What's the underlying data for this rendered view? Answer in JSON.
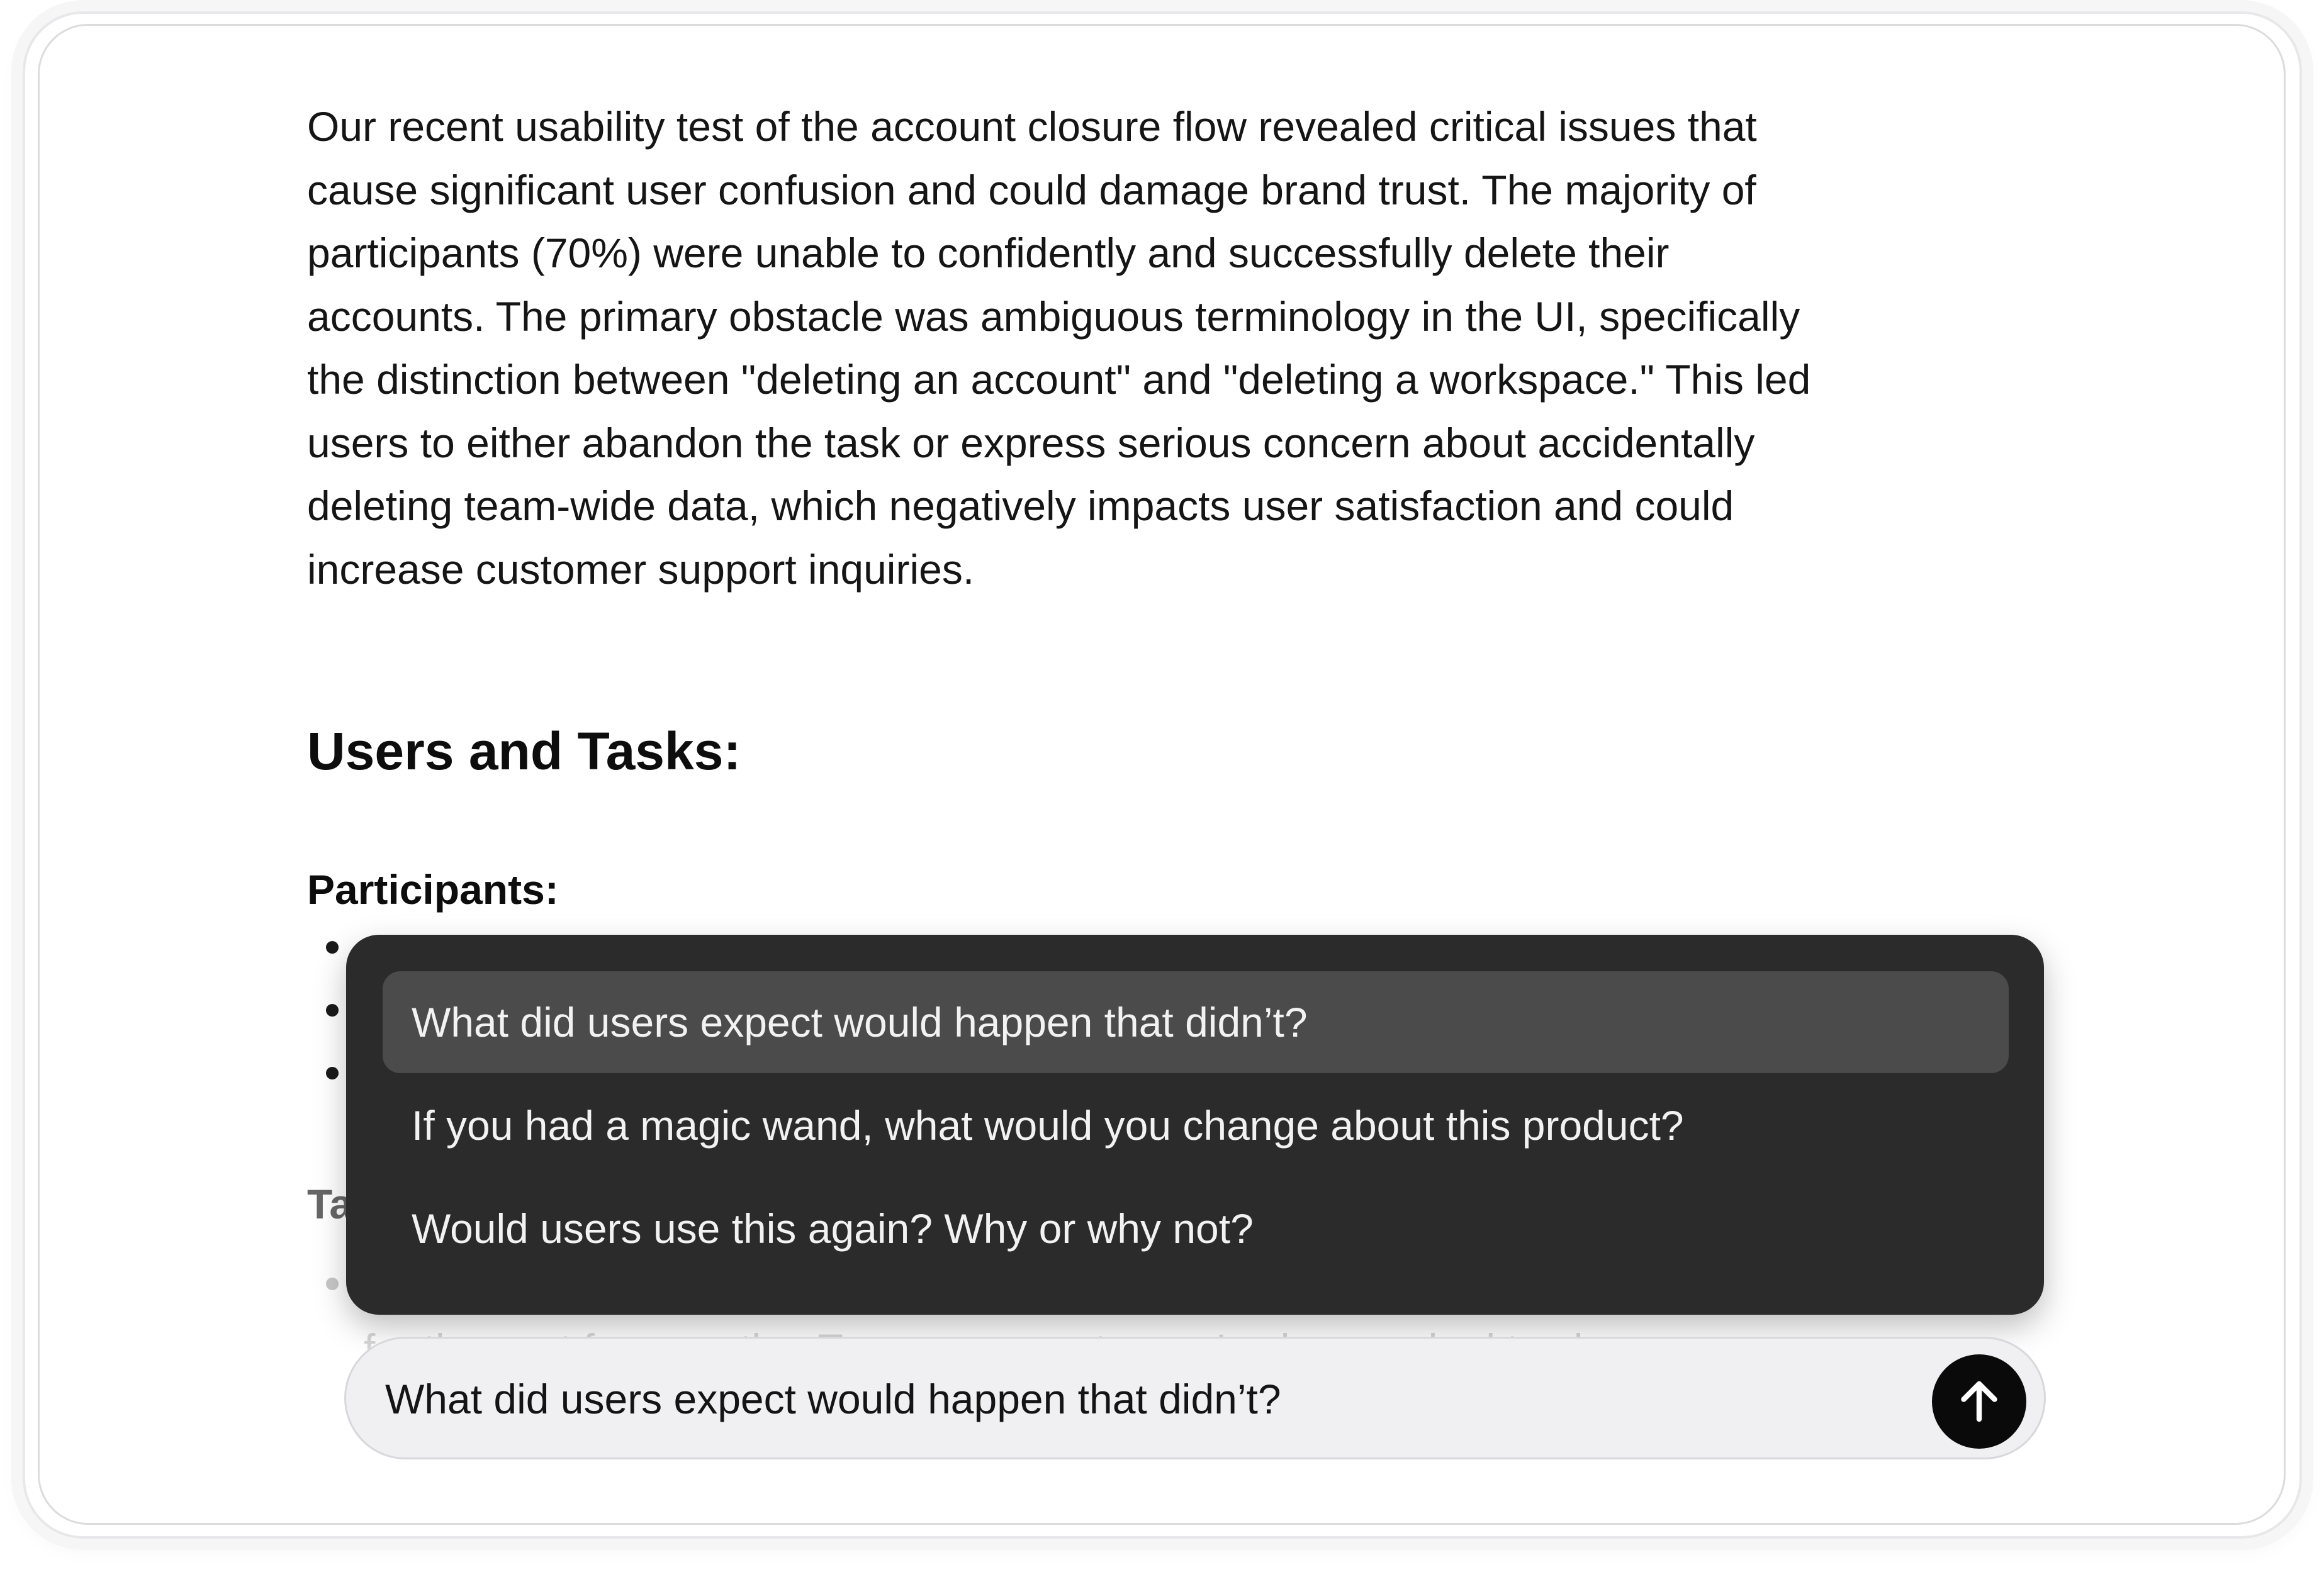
{
  "document": {
    "summary_paragraph": "Our recent usability test of the account closure flow revealed critical issues that cause significant user confusion and could damage brand trust. The majority of participants (70%) were unable to confidently and successfully delete their accounts. The primary obstacle was ambiguous terminology in the UI, specifically the distinction between \"deleting an account\" and \"deleting a workspace.\" This led users to either abandon the task or express serious concern about accidentally deleting team-wide data, which negatively impacts user satisfaction and could increase customer support inquiries.",
    "section_heading": "Users and Tasks:",
    "participants_label": "Participants:",
    "tasks_label_partial": "Ta",
    "faint_task_text": "for the next few months. To save on costs, you've been asked to close"
  },
  "suggestions": {
    "items": [
      "What did users expect would happen that didn’t?",
      "If you had a magic wand, what would you change about this product?",
      "Would users use this again? Why or why not?"
    ],
    "selected_index": 0
  },
  "chat_input": {
    "value": "What did users expect would happen that didn’t?"
  },
  "send_button": {
    "icon": "arrow-up-icon"
  }
}
